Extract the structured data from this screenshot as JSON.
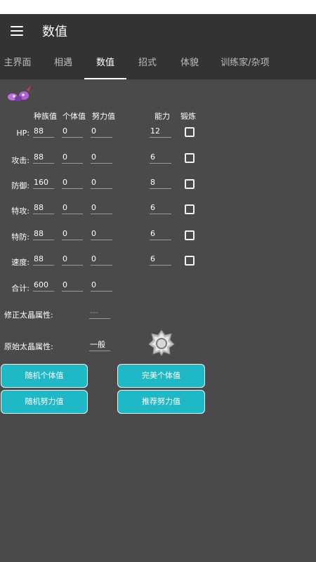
{
  "app": {
    "title": "数值"
  },
  "tabs": [
    {
      "label": "主界面"
    },
    {
      "label": "相遇"
    },
    {
      "label": "数值"
    },
    {
      "label": "招式"
    },
    {
      "label": "体貌"
    },
    {
      "label": "训练家/杂项"
    }
  ],
  "headers": {
    "base": "种族值",
    "iv": "个体值",
    "ev": "努力值",
    "stat": "能力",
    "train": "锻炼"
  },
  "rows": [
    {
      "label": "HP:",
      "base": "88",
      "iv": "0",
      "ev": "0",
      "stat": "12"
    },
    {
      "label": "攻击:",
      "base": "88",
      "iv": "0",
      "ev": "0",
      "stat": "6"
    },
    {
      "label": "防御:",
      "base": "160",
      "iv": "0",
      "ev": "0",
      "stat": "8"
    },
    {
      "label": "特攻:",
      "base": "88",
      "iv": "0",
      "ev": "0",
      "stat": "6"
    },
    {
      "label": "特防:",
      "base": "88",
      "iv": "0",
      "ev": "0",
      "stat": "6"
    },
    {
      "label": "速度:",
      "base": "88",
      "iv": "0",
      "ev": "0",
      "stat": "6"
    }
  ],
  "total": {
    "label": "合计:",
    "base": "600",
    "iv": "0",
    "ev": "0"
  },
  "tera": {
    "modified_label": "修正太晶属性:",
    "modified_value": "---",
    "original_label": "原始太晶属性:",
    "original_value": "一般"
  },
  "buttons": {
    "random_iv": "随机个体值",
    "perfect_iv": "完美个体值",
    "random_ev": "随机努力值",
    "suggest_ev": "推荐努力值"
  },
  "colors": {
    "button": "#1fb8c7",
    "appbar": "#333333",
    "background": "#4a4a4a"
  }
}
